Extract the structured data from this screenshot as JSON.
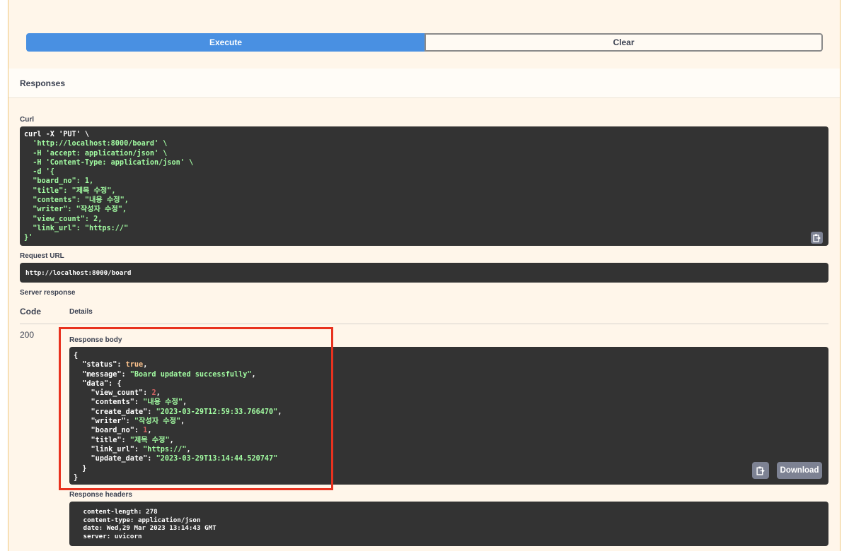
{
  "buttons": {
    "execute": "Execute",
    "clear": "Clear",
    "download": "Download"
  },
  "responses": {
    "title": "Responses"
  },
  "curl": {
    "label": "Curl",
    "lines": [
      "curl -X 'PUT' \\",
      "  'http://localhost:8000/board' \\",
      "  -H 'accept: application/json' \\",
      "  -H 'Content-Type: application/json' \\",
      "  -d '{",
      "  \"board_no\": 1,",
      "  \"title\": \"제목 수정\",",
      "  \"contents\": \"내용 수정\",",
      "  \"writer\": \"작성자 수정\",",
      "  \"view_count\": 2,",
      "  \"link_url\": \"https://\"",
      "}'"
    ]
  },
  "request_url": {
    "label": "Request URL",
    "value": "http://localhost:8000/board"
  },
  "server_response": {
    "label": "Server response",
    "col_code": "Code",
    "col_details": "Details",
    "code": "200",
    "body_label": "Response body",
    "body": {
      "open": "{",
      "status_key": "\"status\"",
      "status_val": "true",
      "message_key": "\"message\"",
      "message_val": "\"Board updated successfully\"",
      "data_key": "\"data\"",
      "fields": [
        {
          "key": "\"view_count\"",
          "val": "2",
          "type": "num"
        },
        {
          "key": "\"contents\"",
          "val": "\"내용 수정\"",
          "type": "str"
        },
        {
          "key": "\"create_date\"",
          "val": "\"2023-03-29T12:59:33.766470\"",
          "type": "str"
        },
        {
          "key": "\"writer\"",
          "val": "\"작성자 수정\"",
          "type": "str"
        },
        {
          "key": "\"board_no\"",
          "val": "1",
          "type": "num"
        },
        {
          "key": "\"title\"",
          "val": "\"제목 수정\"",
          "type": "str"
        },
        {
          "key": "\"link_url\"",
          "val": "\"https://\"",
          "type": "str"
        },
        {
          "key": "\"update_date\"",
          "val": "\"2023-03-29T13:14:44.520747\"",
          "type": "str"
        }
      ],
      "close_inner": "}",
      "close": "}"
    },
    "headers_label": "Response headers",
    "headers": [
      " content-length: 278 ",
      " content-type: application/json ",
      " date: Wed,29 Mar 2023 13:14:43 GMT ",
      " server: uvicorn "
    ]
  },
  "icons": {
    "copy": "copy-icon",
    "highlight_color": "#e8321f",
    "execute_color": "#4990e2"
  }
}
